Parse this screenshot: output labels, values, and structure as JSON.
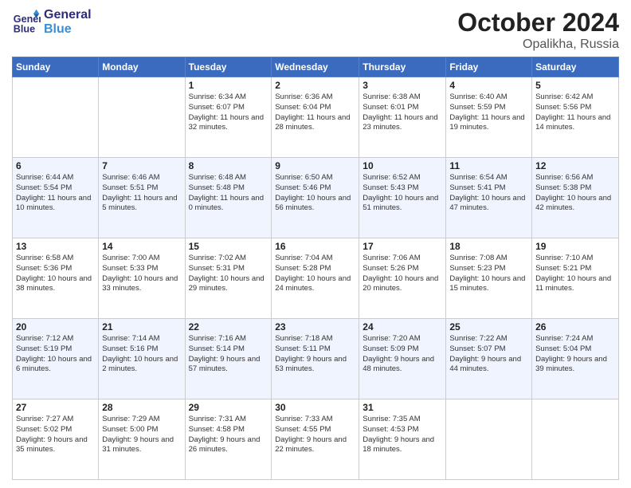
{
  "header": {
    "logo_line1": "General",
    "logo_line2": "Blue",
    "month": "October 2024",
    "location": "Opalikha, Russia"
  },
  "days_of_week": [
    "Sunday",
    "Monday",
    "Tuesday",
    "Wednesday",
    "Thursday",
    "Friday",
    "Saturday"
  ],
  "weeks": [
    [
      {
        "day": "",
        "info": ""
      },
      {
        "day": "",
        "info": ""
      },
      {
        "day": "1",
        "info": "Sunrise: 6:34 AM\nSunset: 6:07 PM\nDaylight: 11 hours and 32 minutes."
      },
      {
        "day": "2",
        "info": "Sunrise: 6:36 AM\nSunset: 6:04 PM\nDaylight: 11 hours and 28 minutes."
      },
      {
        "day": "3",
        "info": "Sunrise: 6:38 AM\nSunset: 6:01 PM\nDaylight: 11 hours and 23 minutes."
      },
      {
        "day": "4",
        "info": "Sunrise: 6:40 AM\nSunset: 5:59 PM\nDaylight: 11 hours and 19 minutes."
      },
      {
        "day": "5",
        "info": "Sunrise: 6:42 AM\nSunset: 5:56 PM\nDaylight: 11 hours and 14 minutes."
      }
    ],
    [
      {
        "day": "6",
        "info": "Sunrise: 6:44 AM\nSunset: 5:54 PM\nDaylight: 11 hours and 10 minutes."
      },
      {
        "day": "7",
        "info": "Sunrise: 6:46 AM\nSunset: 5:51 PM\nDaylight: 11 hours and 5 minutes."
      },
      {
        "day": "8",
        "info": "Sunrise: 6:48 AM\nSunset: 5:48 PM\nDaylight: 11 hours and 0 minutes."
      },
      {
        "day": "9",
        "info": "Sunrise: 6:50 AM\nSunset: 5:46 PM\nDaylight: 10 hours and 56 minutes."
      },
      {
        "day": "10",
        "info": "Sunrise: 6:52 AM\nSunset: 5:43 PM\nDaylight: 10 hours and 51 minutes."
      },
      {
        "day": "11",
        "info": "Sunrise: 6:54 AM\nSunset: 5:41 PM\nDaylight: 10 hours and 47 minutes."
      },
      {
        "day": "12",
        "info": "Sunrise: 6:56 AM\nSunset: 5:38 PM\nDaylight: 10 hours and 42 minutes."
      }
    ],
    [
      {
        "day": "13",
        "info": "Sunrise: 6:58 AM\nSunset: 5:36 PM\nDaylight: 10 hours and 38 minutes."
      },
      {
        "day": "14",
        "info": "Sunrise: 7:00 AM\nSunset: 5:33 PM\nDaylight: 10 hours and 33 minutes."
      },
      {
        "day": "15",
        "info": "Sunrise: 7:02 AM\nSunset: 5:31 PM\nDaylight: 10 hours and 29 minutes."
      },
      {
        "day": "16",
        "info": "Sunrise: 7:04 AM\nSunset: 5:28 PM\nDaylight: 10 hours and 24 minutes."
      },
      {
        "day": "17",
        "info": "Sunrise: 7:06 AM\nSunset: 5:26 PM\nDaylight: 10 hours and 20 minutes."
      },
      {
        "day": "18",
        "info": "Sunrise: 7:08 AM\nSunset: 5:23 PM\nDaylight: 10 hours and 15 minutes."
      },
      {
        "day": "19",
        "info": "Sunrise: 7:10 AM\nSunset: 5:21 PM\nDaylight: 10 hours and 11 minutes."
      }
    ],
    [
      {
        "day": "20",
        "info": "Sunrise: 7:12 AM\nSunset: 5:19 PM\nDaylight: 10 hours and 6 minutes."
      },
      {
        "day": "21",
        "info": "Sunrise: 7:14 AM\nSunset: 5:16 PM\nDaylight: 10 hours and 2 minutes."
      },
      {
        "day": "22",
        "info": "Sunrise: 7:16 AM\nSunset: 5:14 PM\nDaylight: 9 hours and 57 minutes."
      },
      {
        "day": "23",
        "info": "Sunrise: 7:18 AM\nSunset: 5:11 PM\nDaylight: 9 hours and 53 minutes."
      },
      {
        "day": "24",
        "info": "Sunrise: 7:20 AM\nSunset: 5:09 PM\nDaylight: 9 hours and 48 minutes."
      },
      {
        "day": "25",
        "info": "Sunrise: 7:22 AM\nSunset: 5:07 PM\nDaylight: 9 hours and 44 minutes."
      },
      {
        "day": "26",
        "info": "Sunrise: 7:24 AM\nSunset: 5:04 PM\nDaylight: 9 hours and 39 minutes."
      }
    ],
    [
      {
        "day": "27",
        "info": "Sunrise: 7:27 AM\nSunset: 5:02 PM\nDaylight: 9 hours and 35 minutes."
      },
      {
        "day": "28",
        "info": "Sunrise: 7:29 AM\nSunset: 5:00 PM\nDaylight: 9 hours and 31 minutes."
      },
      {
        "day": "29",
        "info": "Sunrise: 7:31 AM\nSunset: 4:58 PM\nDaylight: 9 hours and 26 minutes."
      },
      {
        "day": "30",
        "info": "Sunrise: 7:33 AM\nSunset: 4:55 PM\nDaylight: 9 hours and 22 minutes."
      },
      {
        "day": "31",
        "info": "Sunrise: 7:35 AM\nSunset: 4:53 PM\nDaylight: 9 hours and 18 minutes."
      },
      {
        "day": "",
        "info": ""
      },
      {
        "day": "",
        "info": ""
      }
    ]
  ]
}
